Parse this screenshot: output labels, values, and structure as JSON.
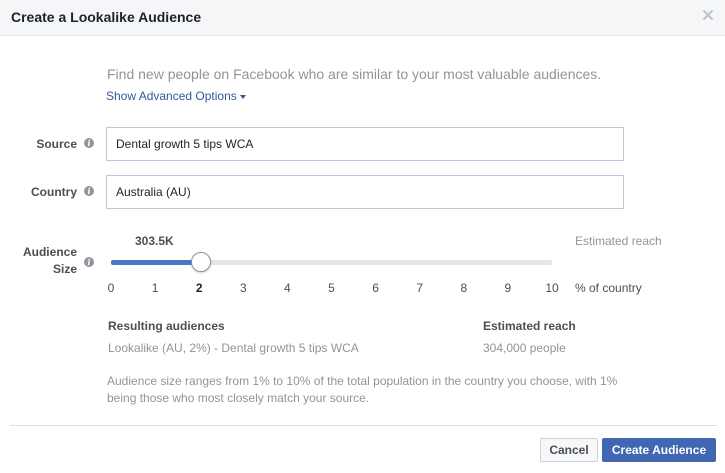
{
  "dialog": {
    "title": "Create a Lookalike Audience",
    "intro": "Find new people on Facebook who are similar to your most valuable audiences.",
    "advanced_link": "Show Advanced Options"
  },
  "source": {
    "label": "Source",
    "value": "Dental growth 5 tips WCA"
  },
  "country": {
    "label": "Country",
    "value": "Australia (AU)"
  },
  "audience_size": {
    "label_line1": "Audience",
    "label_line2": "Size",
    "reach_value": "303.5K",
    "estimated_reach_label": "Estimated reach",
    "selected_percent": 2,
    "ticks": [
      "0",
      "1",
      "2",
      "3",
      "4",
      "5",
      "6",
      "7",
      "8",
      "9",
      "10"
    ],
    "unit_label": "% of country"
  },
  "results": {
    "resulting_header": "Resulting audiences",
    "resulting_value": "Lookalike (AU, 2%) - Dental growth 5 tips WCA",
    "reach_header": "Estimated reach",
    "reach_value": "304,000 people"
  },
  "note": "Audience size ranges from 1% to 10% of the total population in the country you choose, with 1% being those who most closely match your source.",
  "buttons": {
    "cancel": "Cancel",
    "create": "Create Audience"
  },
  "colors": {
    "primary": "#4267b2",
    "link": "#365899",
    "slider_fill": "#4a76c7"
  }
}
